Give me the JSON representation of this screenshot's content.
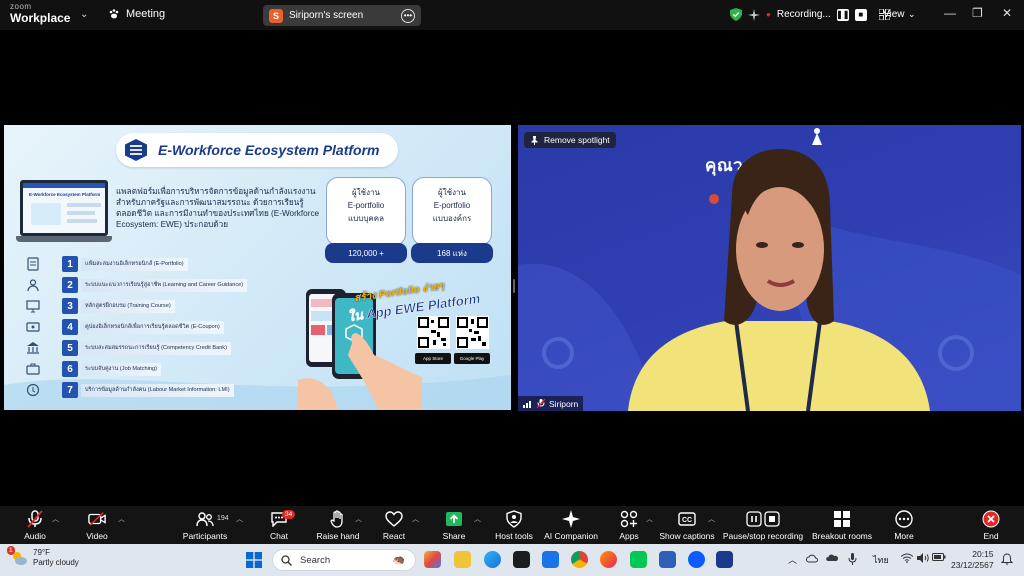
{
  "titlebar": {
    "brand_line1": "zoom",
    "brand_line2": "Workplace",
    "meeting_label": "Meeting",
    "share_owner_initial": "S",
    "share_label": "Siriporn's screen",
    "recording_label": "Recording...",
    "view_label": "View"
  },
  "slide": {
    "title": "E-Workforce Ecosystem Platform",
    "description": "แพลตฟอร์มเพื่อการบริหารจัดการข้อมูลด้านกำลังแรงงาน สำหรับภาครัฐและการพัฒนาสมรรถนะ ด้วยการเรียนรู้ตลอดชีวิต และการมีงานทำของประเทศไทย (E-Workforce Ecosystem: EWE) ประกอบด้วย",
    "laptop_caption": "E-Workforce Ecosystem Platform",
    "cards": [
      {
        "line1": "ผู้ใช้งาน",
        "line2": "E-portfolio",
        "line3": "แบบบุคคล",
        "value": "120,000 +"
      },
      {
        "line1": "ผู้ใช้งาน",
        "line2": "E-portfolio",
        "line3": "แบบองค์กร",
        "value": "168 แห่ง"
      }
    ],
    "features": [
      {
        "num": "1",
        "label": "แฟ้มสะสมงานอิเล็กทรอนิกส์ (E-Portfolio)"
      },
      {
        "num": "2",
        "label": "ระบบแนะแนวการเรียนรู้สู่อาชีพ (Learning and Career Guidance)"
      },
      {
        "num": "3",
        "label": "หลักสูตรฝึกอบรม (Training Course)"
      },
      {
        "num": "4",
        "label": "คูปองอิเล็กทรอนิกส์เพื่อการเรียนรู้ตลอดชีวิต (E-Coupon)"
      },
      {
        "num": "5",
        "label": "ระบบสะสมสมรรถนะการเรียนรู้ (Competency Credit Bank)"
      },
      {
        "num": "6",
        "label": "ระบบจับคู่งาน (Job Matching)"
      },
      {
        "num": "7",
        "label": "บริการข้อมูลด้านกำลังคน (Labour Market Information: LMI)"
      }
    ],
    "promo_line1": "สร้าง Portfolio ง่ายๆ",
    "promo_line2": "ใน App EWE Platform",
    "app_store_label": "App Store",
    "google_play_label": "Google Play"
  },
  "video": {
    "spotlight_button": "Remove spotlight",
    "background_text": "คุณวุฒิวิชาชีพ",
    "participant_name": "Siriporn"
  },
  "toolbar": {
    "audio": "Audio",
    "video": "Video",
    "participants": "Participants",
    "participants_count": "194",
    "chat": "Chat",
    "chat_badge": "34",
    "raise_hand": "Raise hand",
    "react": "React",
    "share": "Share",
    "host_tools": "Host tools",
    "ai_companion": "AI Companion",
    "apps": "Apps",
    "show_captions": "Show captions",
    "pause_stop_recording": "Pause/stop recording",
    "breakout_rooms": "Breakout rooms",
    "more": "More",
    "end": "End"
  },
  "taskbar": {
    "weather_badge": "1",
    "temperature": "79°F",
    "condition": "Partly cloudy",
    "search_placeholder": "Search",
    "language": "ไทย",
    "time": "20:15",
    "date": "23/12/2567"
  },
  "colors": {
    "accent_blue": "#2352b0",
    "end_red": "#e02828",
    "share_green": "#1fb85a",
    "video_bg": "#2f3fb2"
  }
}
